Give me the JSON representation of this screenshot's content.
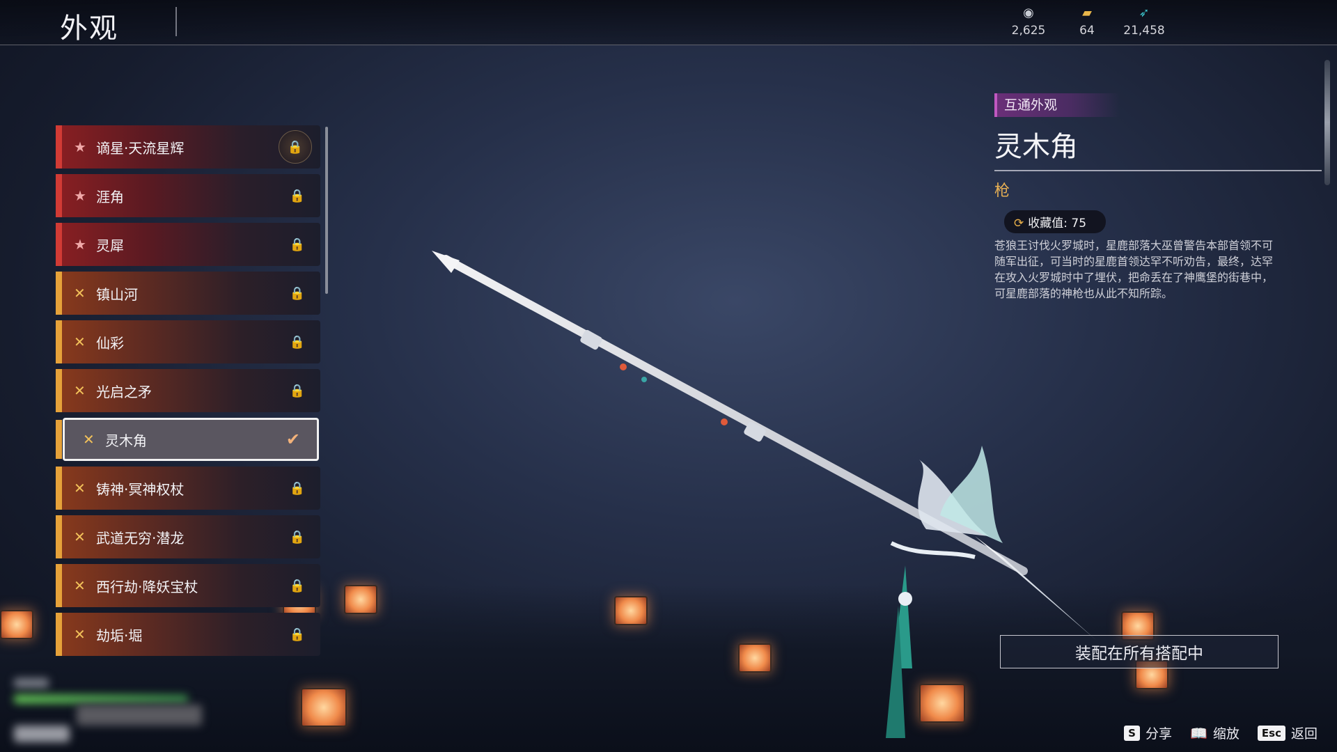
{
  "header": {
    "title": "外观"
  },
  "currencies": [
    {
      "icon": "coin-icon",
      "value": "2,625"
    },
    {
      "icon": "ticket-icon",
      "value": "64"
    },
    {
      "icon": "feather-icon",
      "value": "21,458"
    }
  ],
  "list": {
    "items": [
      {
        "name": "谪星·天流星辉",
        "rarity": "red",
        "icon": "★",
        "lock": "🔒"
      },
      {
        "name": "涯角",
        "rarity": "red",
        "icon": "★",
        "lock": "🔒"
      },
      {
        "name": "灵犀",
        "rarity": "red",
        "icon": "★",
        "lock": "🔒"
      },
      {
        "name": "镇山河",
        "rarity": "gold",
        "icon": "✕",
        "lock": "🔒"
      },
      {
        "name": "仙彩",
        "rarity": "gold",
        "icon": "✕",
        "lock": "🔒"
      },
      {
        "name": "光启之矛",
        "rarity": "gold",
        "icon": "✕",
        "lock": "🔒"
      },
      {
        "name": "灵木角",
        "rarity": "gold",
        "icon": "✕",
        "check": "✔"
      },
      {
        "name": "铸神·冥神权杖",
        "rarity": "gold",
        "icon": "✕",
        "lock": "🔒"
      },
      {
        "name": "武道无穷·潜龙",
        "rarity": "gold",
        "icon": "✕",
        "lock": "🔒"
      },
      {
        "name": "西行劫·降妖宝杖",
        "rarity": "gold",
        "icon": "✕",
        "lock": "🔒"
      },
      {
        "name": "劫垢·堀",
        "rarity": "gold",
        "icon": "✕",
        "lock": "🔒"
      }
    ]
  },
  "detail": {
    "tag": "互通外观",
    "name": "灵木角",
    "type": "枪",
    "collect_label": "收藏值: 75",
    "description": "苍狼王讨伐火罗城时，星鹿部落大巫曾警告本部首领不可随军出征，可当时的星鹿首领达罕不听劝告，最终，达罕在攻入火罗城时中了埋伏，把命丢在了神鹰堡的街巷中，可星鹿部落的神枪也从此不知所踪。",
    "equip_button": "装配在所有搭配中"
  },
  "hints": [
    {
      "key": "S",
      "label": "分享"
    },
    {
      "key": "📖",
      "label": "缩放"
    },
    {
      "key": "Esc",
      "label": "返回"
    }
  ]
}
